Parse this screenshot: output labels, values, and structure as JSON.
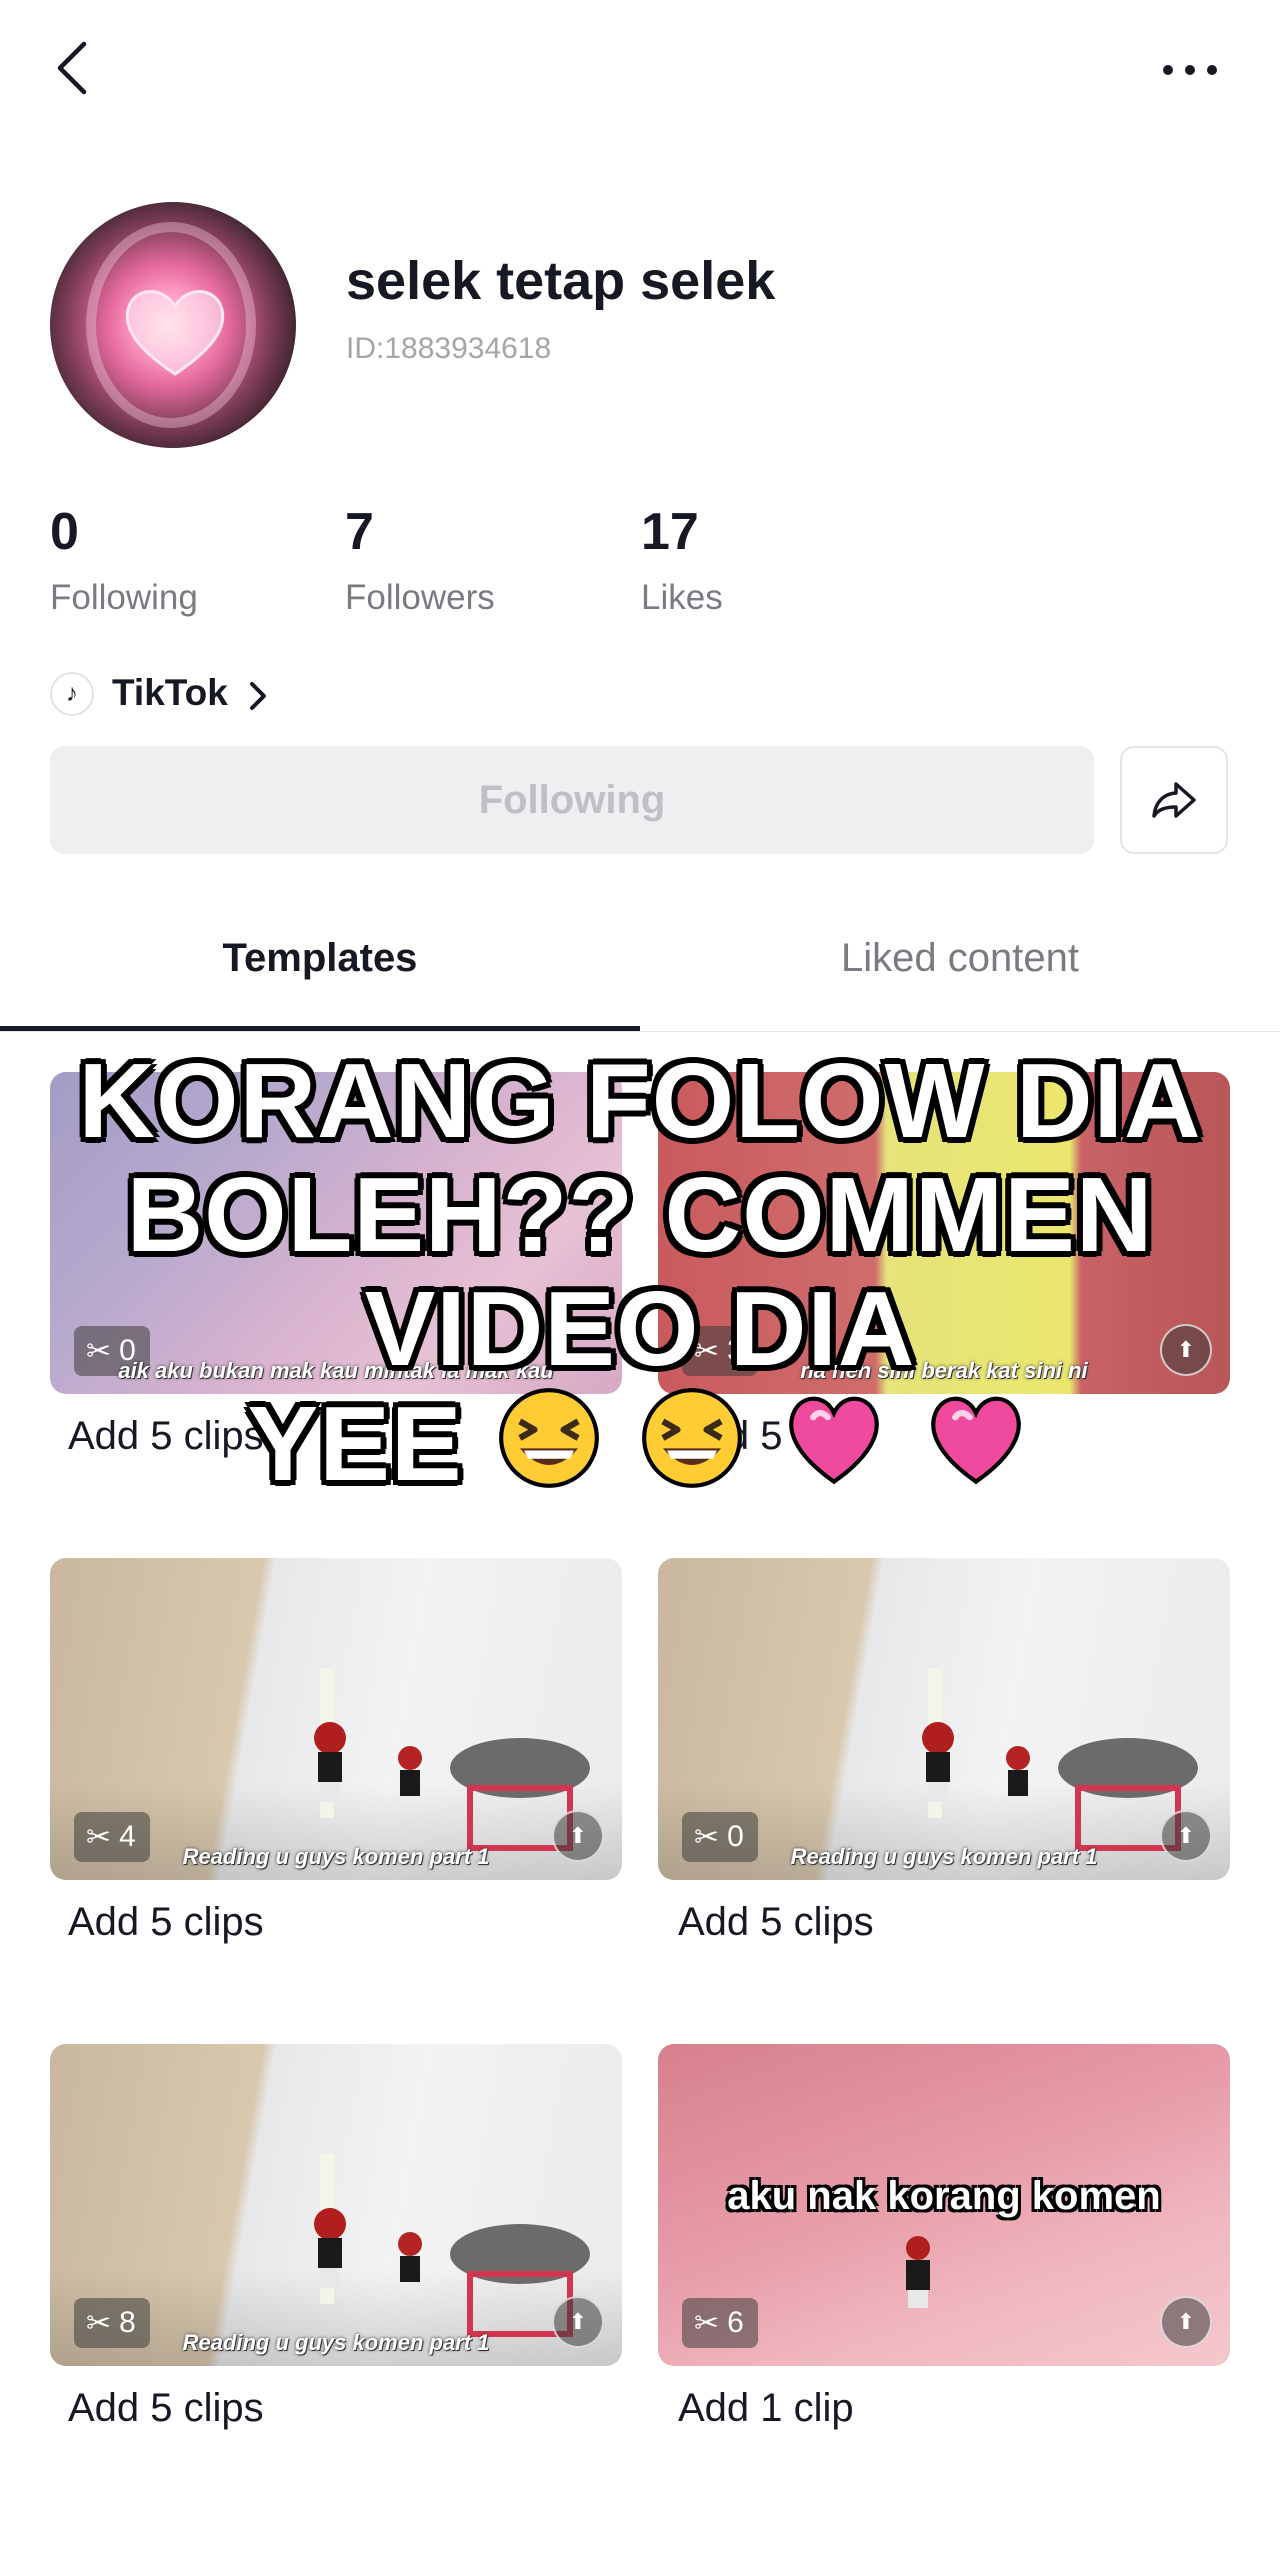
{
  "header": {
    "back_icon": "chevron-left-icon",
    "more_icon": "ellipsis-icon"
  },
  "profile": {
    "username": "selek tetap selek",
    "id_text": "ID:1883934618"
  },
  "stats": [
    {
      "value": "0",
      "label": "Following"
    },
    {
      "value": "7",
      "label": "Followers"
    },
    {
      "value": "17",
      "label": "Likes"
    }
  ],
  "link": {
    "label": "TikTok",
    "icon": "tiktok-icon"
  },
  "buttons": {
    "follow_label": "Following",
    "share_icon": "share-icon"
  },
  "tabs": [
    {
      "label": "Templates",
      "active": true
    },
    {
      "label": "Liked content",
      "active": false
    }
  ],
  "cards": [
    {
      "clips": "0",
      "title": "Add 5 clips",
      "subtitle": "aik aku bukan mak kau mintak la mak kau"
    },
    {
      "clips": "3",
      "title": "Add 5 clips",
      "subtitle": "na hen sini berak kat sini ni"
    },
    {
      "clips": "4",
      "title": "Add 5 clips",
      "subtitle": "Reading u guys komen part 1"
    },
    {
      "clips": "0",
      "title": "Add 5 clips",
      "subtitle": "Reading u guys komen part 1"
    },
    {
      "clips": "8",
      "title": "Add 5 clips",
      "subtitle": "Reading u guys komen part 1"
    },
    {
      "clips": "6",
      "title": "Add 1 clip",
      "subtitle": "aku nak korang komen"
    }
  ],
  "overlay": {
    "line1": "KORANG FOLOW DIA",
    "line2": "BOLEH?? COMMEN",
    "line3": "VIDEO DIA",
    "line4": "YEE"
  },
  "colors": {
    "text": "#161823",
    "muted": "#7a7b82",
    "button_bg": "#efeff1",
    "accent_pink": "#e3358b"
  }
}
